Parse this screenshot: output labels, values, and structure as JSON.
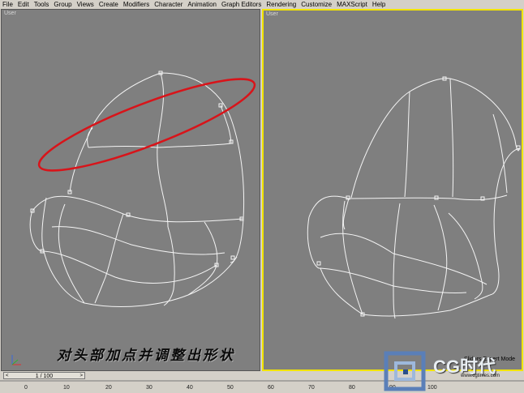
{
  "menu": [
    "File",
    "Edit",
    "Tools",
    "Group",
    "Views",
    "Create",
    "Modifiers",
    "Character",
    "Animation",
    "Graph Editors",
    "Rendering",
    "Customize",
    "MAXScript",
    "Help"
  ],
  "viewports": {
    "left_label": "User",
    "right_label": "User"
  },
  "timeslider": {
    "frame": "1 / 100",
    "prev": "<",
    "next": ">"
  },
  "ruler_ticks": [
    "0",
    "10",
    "20",
    "30",
    "40",
    "50",
    "60",
    "70",
    "80",
    "90",
    "100"
  ],
  "caption": "对头部加点并调整出形状",
  "logo": {
    "text": "CG时代",
    "url": "www.cgtimes.com"
  },
  "status": "Sliders Expert Mode",
  "colors": {
    "active_viewport_border": "#f2e400",
    "selection_highlight": "#d8141a",
    "viewport_bg": "#7f7f7f"
  }
}
